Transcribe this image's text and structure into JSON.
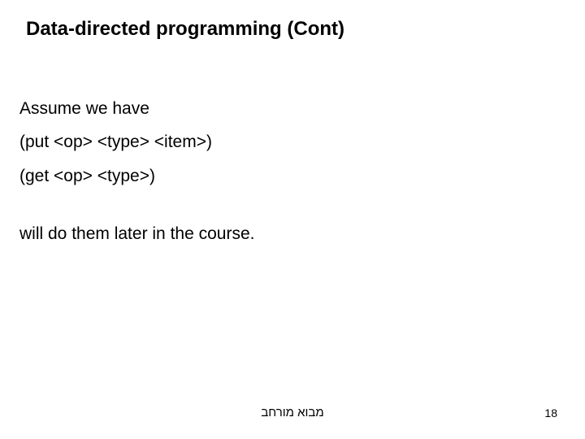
{
  "title": "Data-directed programming (Cont)",
  "body": {
    "line1": "Assume we have",
    "line2": "(put <op> <type> <item>)",
    "line3": "(get <op> <type>)",
    "line4": "will do them later in the course."
  },
  "footer": "מבוא מורחב",
  "page": "18"
}
